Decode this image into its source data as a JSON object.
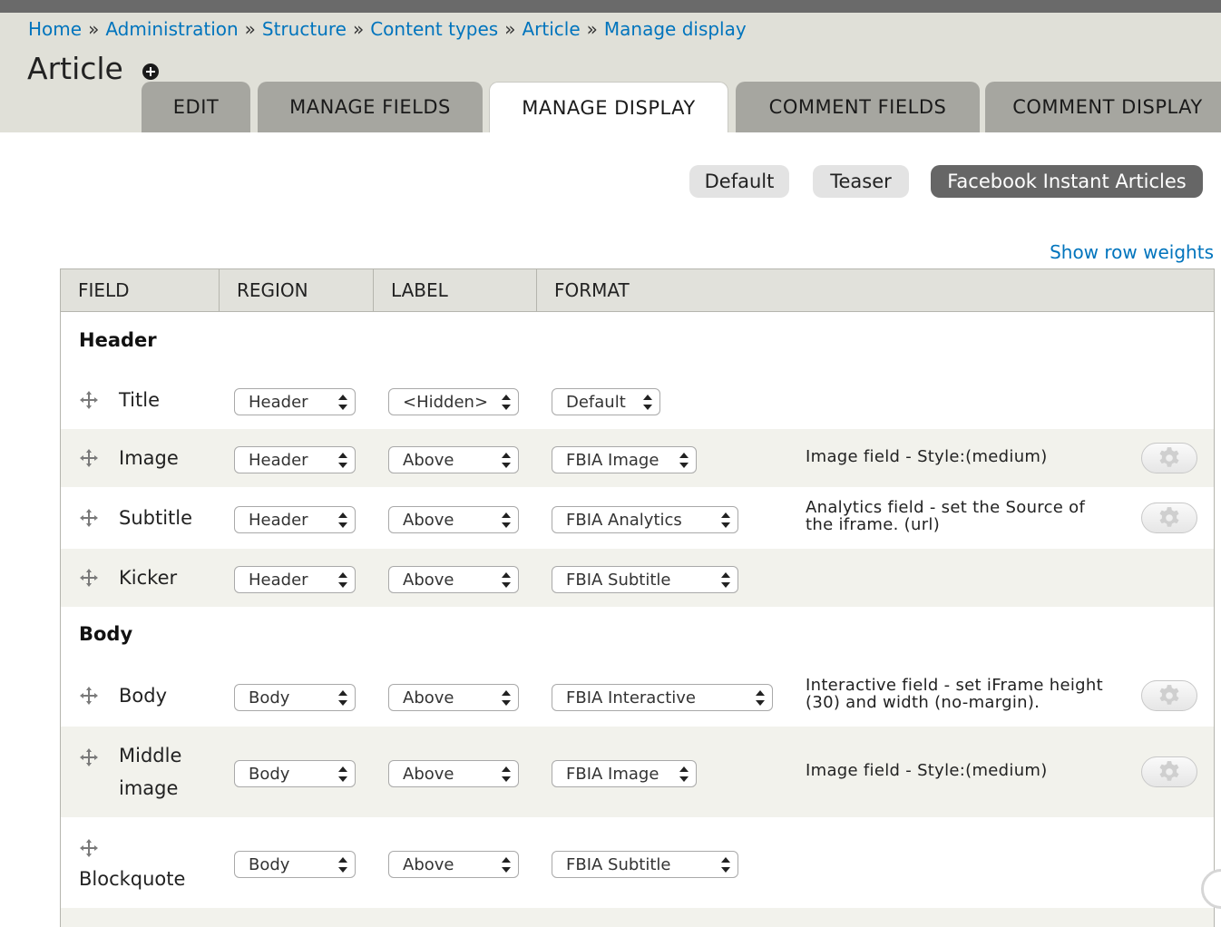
{
  "breadcrumb": {
    "items": [
      "Home",
      "Administration",
      "Structure",
      "Content types",
      "Article",
      "Manage display"
    ],
    "separator": "»"
  },
  "page": {
    "title": "Article"
  },
  "tabs": [
    {
      "label": "EDIT",
      "active": false
    },
    {
      "label": "MANAGE FIELDS",
      "active": false
    },
    {
      "label": "MANAGE DISPLAY",
      "active": true
    },
    {
      "label": "COMMENT FIELDS",
      "active": false
    },
    {
      "label": "COMMENT DISPLAY",
      "active": false
    }
  ],
  "display_modes": [
    {
      "label": "Default",
      "active": false
    },
    {
      "label": "Teaser",
      "active": false
    },
    {
      "label": "Facebook Instant Articles",
      "active": true
    }
  ],
  "show_row_weights": "Show row weights",
  "table": {
    "columns": [
      "FIELD",
      "REGION",
      "LABEL",
      "FORMAT"
    ],
    "regions": [
      {
        "title": "Header",
        "rows": [
          {
            "field": "Title",
            "region": "Header",
            "label": "<Hidden>",
            "format": "Default",
            "summary": "",
            "has_settings": false
          },
          {
            "field": "Image",
            "region": "Header",
            "label": "Above",
            "format": "FBIA Image",
            "summary": "Image field - Style:(medium)",
            "has_settings": true
          },
          {
            "field": "Subtitle",
            "region": "Header",
            "label": "Above",
            "format": "FBIA Analytics",
            "summary_lines": [
              "Analytics field - set the Source of",
              "the iframe. (url)"
            ],
            "has_settings": true
          },
          {
            "field": "Kicker",
            "region": "Header",
            "label": "Above",
            "format": "FBIA Subtitle",
            "summary": "",
            "has_settings": false
          }
        ]
      },
      {
        "title": "Body",
        "rows": [
          {
            "field": "Body",
            "region": "Body",
            "label": "Above",
            "format": "FBIA Interactive",
            "summary_lines": [
              "Interactive field - set iFrame height",
              "(30) and width (no-margin)."
            ],
            "has_settings": true
          },
          {
            "field_lines": [
              "Middle",
              "image"
            ],
            "region": "Body",
            "label": "Above",
            "format": "FBIA Image",
            "summary": "Image field - Style:(medium)",
            "has_settings": true
          },
          {
            "field": "Blockquote",
            "region": "Body",
            "label": "Above",
            "format": "FBIA Subtitle",
            "summary": "",
            "has_settings": false
          }
        ]
      }
    ]
  },
  "colors": {
    "link": "#0074bd",
    "header_bg": "#e0e0d8",
    "tab_inactive": "#a6a6a0",
    "pill_active": "#666666",
    "row_alt": "#f2f2ec"
  }
}
